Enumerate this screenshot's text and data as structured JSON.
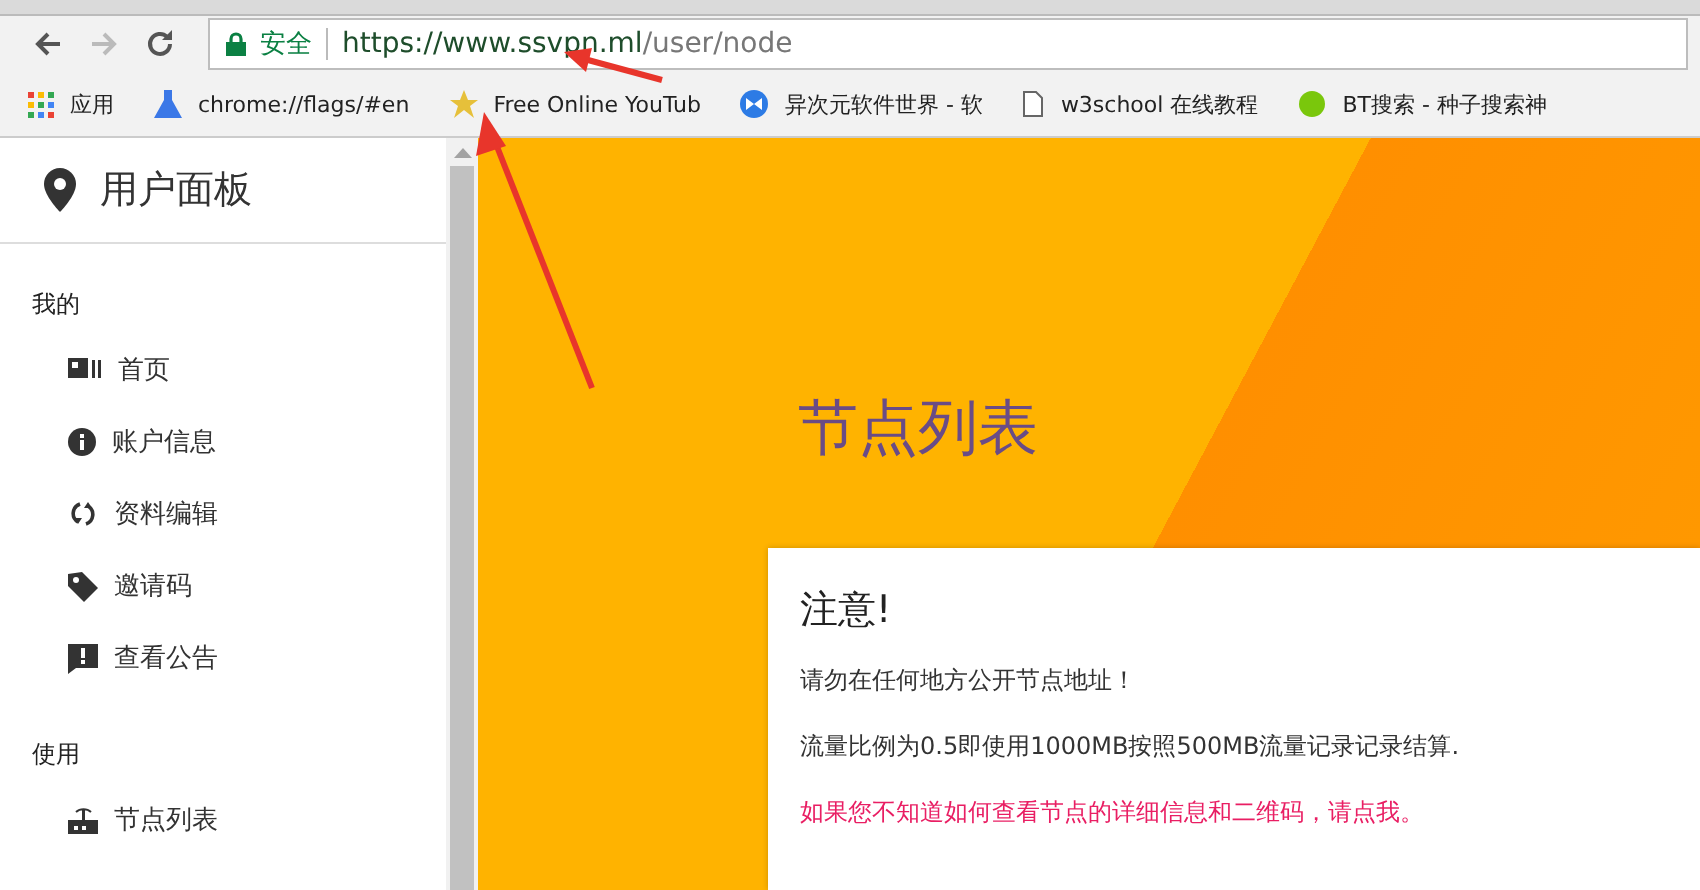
{
  "browser": {
    "security_label": "安全",
    "url_host": "https://www.ssvpn.ml",
    "url_path": "/user/node"
  },
  "bookmarks": [
    {
      "kind": "apps",
      "label": "应用"
    },
    {
      "kind": "flask",
      "label": "chrome://flags/#en"
    },
    {
      "kind": "star",
      "label": "Free Online YouTub"
    },
    {
      "kind": "bowtie",
      "label": "异次元软件世界 - 软"
    },
    {
      "kind": "page",
      "label": "w3school 在线教程"
    },
    {
      "kind": "ball",
      "label": "BT搜索 - 种子搜索神"
    }
  ],
  "sidebar": {
    "title": "用户面板",
    "sections": [
      {
        "label": "我的",
        "items": [
          {
            "kind": "card",
            "label": "首页"
          },
          {
            "kind": "info",
            "label": "账户信息"
          },
          {
            "kind": "sync",
            "label": "资料编辑"
          },
          {
            "kind": "tag",
            "label": "邀请码"
          },
          {
            "kind": "alert",
            "label": "查看公告"
          }
        ]
      },
      {
        "label": "使用",
        "items": [
          {
            "kind": "router",
            "label": "节点列表"
          }
        ]
      }
    ]
  },
  "page_heading": "节点列表",
  "notice": {
    "title": "注意!",
    "lines": [
      {
        "kind": "text",
        "text": "请勿在任何地方公开节点地址！"
      },
      {
        "kind": "text",
        "text": "流量比例为0.5即使用1000MB按照500MB流量记录记录结算."
      },
      {
        "kind": "link",
        "text": "如果您不知道如何查看节点的详细信息和二维码，请点我。"
      }
    ]
  }
}
